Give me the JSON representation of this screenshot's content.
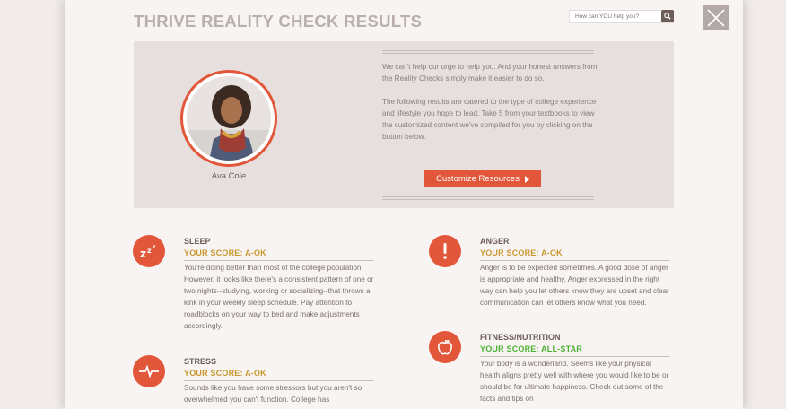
{
  "header": {
    "title": "THRIVE REALITY CHECK RESULTS",
    "search_placeholder": "How can YOU help you?"
  },
  "colors": {
    "accent": "#e2563a",
    "score_ok": "#c8982e",
    "score_allstar": "#4cb034"
  },
  "hero": {
    "name": "Ava Cole",
    "paragraph1": "We can't help our urge to help you. And your honest answers from the Reality Checks simply make it easier to do so.",
    "paragraph2": "The following results are catered to the type of college experience and lifestyle you hope to lead. Take 5 from your textbooks to view the customized content we've compiled for you by clicking on the button below.",
    "button_label": "Customize Resources"
  },
  "sections": [
    {
      "icon": "sleep-zzz-icon",
      "title": "SLEEP",
      "score": "YOUR SCORE: A-OK",
      "body": "You're doing better than most of the college population. However, it looks like there's a consistent pattern of one or two nights--studying, working or socializing--that throws a kink in your weekly sleep schedule. Pay attention to roadblocks on your way to bed and make adjustments accordingly."
    },
    {
      "icon": "heartbeat-icon",
      "title": "STRESS",
      "score": "YOUR SCORE: A-OK",
      "body": "Sounds like you have some stressors but you aren't so overwhelmed you can't function. College has"
    },
    {
      "icon": "exclamation-icon",
      "title": "ANGER",
      "score": "YOUR SCORE: A-OK",
      "body": "Anger is to be expected sometimes. A good dose of anger is appropriate and healthy. Anger expressed in the right way can help you let others know they are upset and clear communication can let others know what you need."
    },
    {
      "icon": "apple-icon",
      "title": "FITNESS/NUTRITION",
      "score": "YOUR SCORE: ALL-STAR",
      "body": "Your body is a wonderland. Seems like your physical health aligns pretty well with where you would like to be or should be for ultimate happiness. Check out some of the facts and tips on"
    }
  ]
}
